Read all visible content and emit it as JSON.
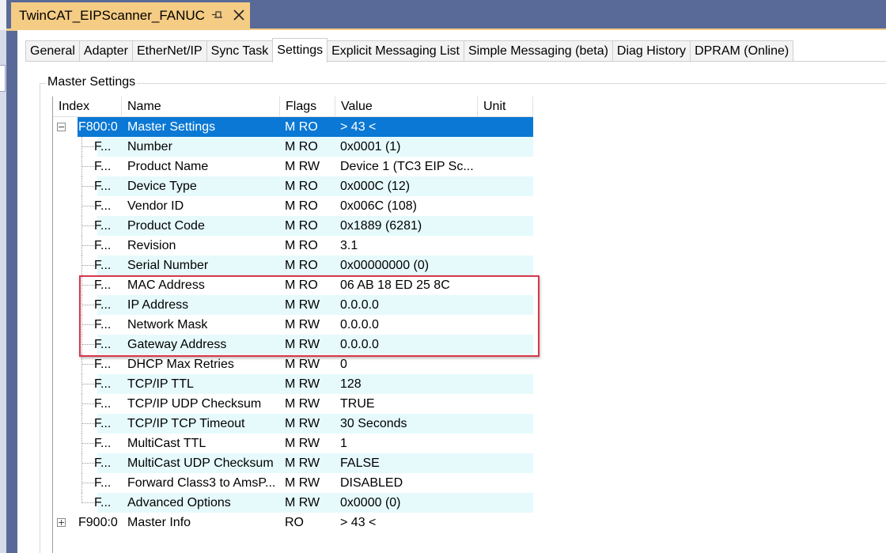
{
  "document_tab": {
    "title": "TwinCAT_EIPScanner_FANUC",
    "pin_icon": "pin-icon",
    "close_icon": "close-icon"
  },
  "tabs": [
    {
      "label": "General",
      "active": false
    },
    {
      "label": "Adapter",
      "active": false
    },
    {
      "label": "EtherNet/IP",
      "active": false
    },
    {
      "label": "Sync Task",
      "active": false
    },
    {
      "label": "Settings",
      "active": true
    },
    {
      "label": "Explicit Messaging List",
      "active": false
    },
    {
      "label": "Simple Messaging (beta)",
      "active": false
    },
    {
      "label": "Diag History",
      "active": false
    },
    {
      "label": "DPRAM (Online)",
      "active": false
    }
  ],
  "group": {
    "label": "Master Settings"
  },
  "grid": {
    "columns": {
      "index": "Index",
      "name": "Name",
      "flags": "Flags",
      "value": "Value",
      "unit": "Unit"
    },
    "parent_master": {
      "index": "F800:0",
      "name": "Master Settings",
      "flags": "M RO",
      "value": "> 43 <",
      "expander": "−"
    },
    "rows": [
      {
        "index": "F...",
        "name": "Number",
        "flags": "M RO",
        "value": "0x0001 (1)"
      },
      {
        "index": "F...",
        "name": "Product Name",
        "flags": "M RW",
        "value": "Device 1 (TC3 EIP Sc..."
      },
      {
        "index": "F...",
        "name": "Device Type",
        "flags": "M RO",
        "value": "0x000C (12)"
      },
      {
        "index": "F...",
        "name": "Vendor ID",
        "flags": "M RO",
        "value": "0x006C (108)"
      },
      {
        "index": "F...",
        "name": "Product Code",
        "flags": "M RO",
        "value": "0x1889 (6281)"
      },
      {
        "index": "F...",
        "name": "Revision",
        "flags": "M RO",
        "value": "3.1"
      },
      {
        "index": "F...",
        "name": "Serial Number",
        "flags": "M RO",
        "value": "0x00000000 (0)"
      },
      {
        "index": "F...",
        "name": "MAC Address",
        "flags": "M RO",
        "value": "06 AB 18 ED 25 8C"
      },
      {
        "index": "F...",
        "name": "IP Address",
        "flags": "M RW",
        "value": "0.0.0.0"
      },
      {
        "index": "F...",
        "name": "Network Mask",
        "flags": "M RW",
        "value": "0.0.0.0"
      },
      {
        "index": "F...",
        "name": "Gateway Address",
        "flags": "M RW",
        "value": "0.0.0.0"
      },
      {
        "index": "F...",
        "name": "DHCP Max Retries",
        "flags": "M RW",
        "value": "0"
      },
      {
        "index": "F...",
        "name": "TCP/IP TTL",
        "flags": "M RW",
        "value": "128"
      },
      {
        "index": "F...",
        "name": "TCP/IP UDP Checksum",
        "flags": "M RW",
        "value": "TRUE"
      },
      {
        "index": "F...",
        "name": "TCP/IP TCP Timeout",
        "flags": "M RW",
        "value": "30 Seconds"
      },
      {
        "index": "F...",
        "name": "MultiCast TTL",
        "flags": "M RW",
        "value": "1"
      },
      {
        "index": "F...",
        "name": "MultiCast UDP Checksum",
        "flags": "M RW",
        "value": "FALSE"
      },
      {
        "index": "F...",
        "name": "Forward Class3 to AmsP...",
        "flags": "M RW",
        "value": "DISABLED"
      },
      {
        "index": "F...",
        "name": "Advanced Options",
        "flags": "M RW",
        "value": "0x0000 (0)"
      }
    ],
    "parent_info": {
      "index": "F900:0",
      "name": "Master Info",
      "flags": "RO",
      "value": "> 43 <",
      "expander": "+"
    }
  },
  "colors": {
    "selected_row": "#0a78d4",
    "alt_row": "#e6fafc",
    "highlight_border": "#d6374a",
    "document_tab": "#f5cc84"
  }
}
